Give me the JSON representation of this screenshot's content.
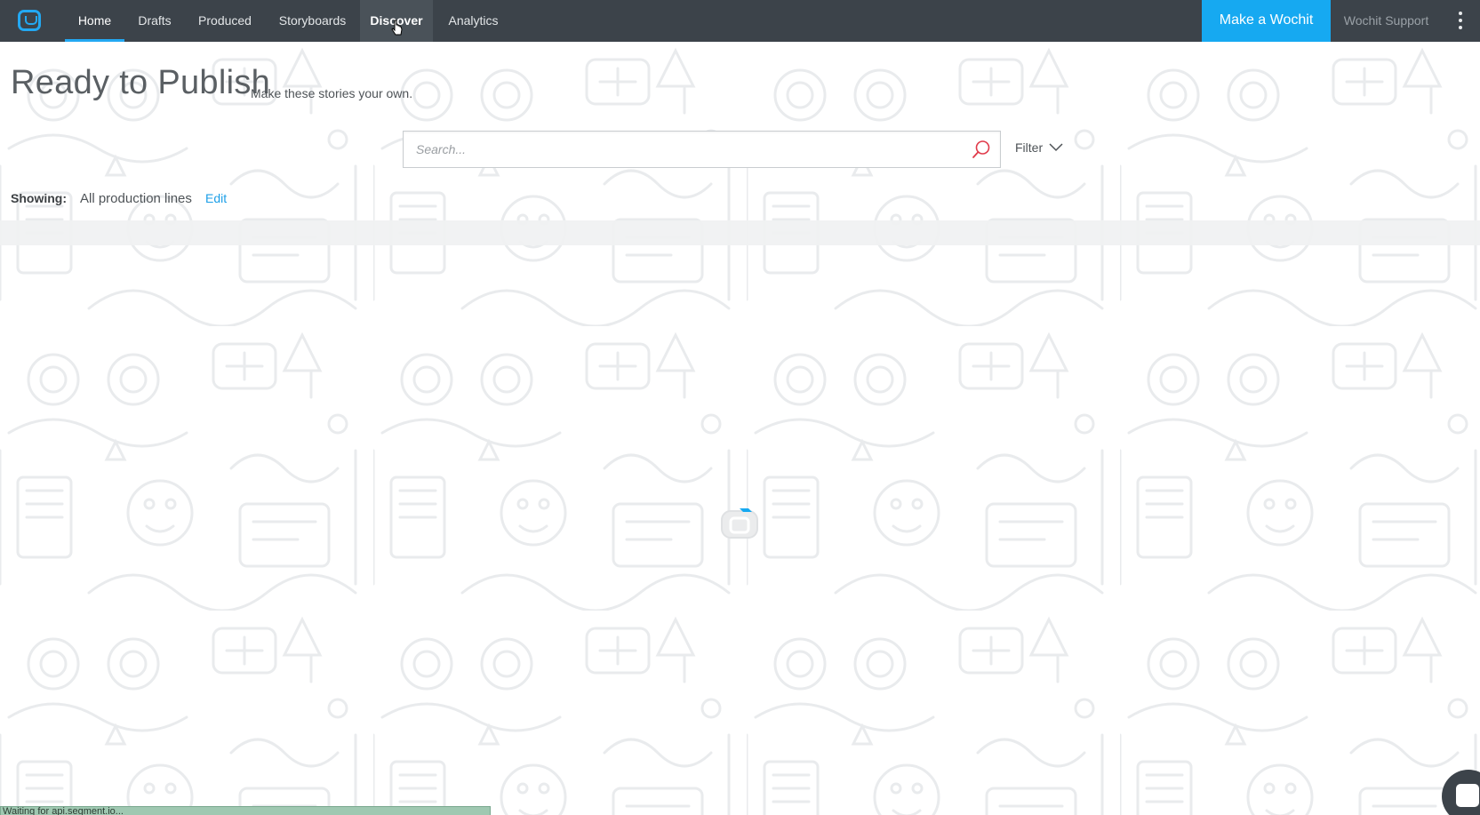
{
  "navbar": {
    "logo": "wochit-logo-icon",
    "items": [
      {
        "label": "Home"
      },
      {
        "label": "Drafts"
      },
      {
        "label": "Produced"
      },
      {
        "label": "Storyboards"
      },
      {
        "label": "Discover"
      },
      {
        "label": "Analytics"
      }
    ],
    "make_button": "Make a Wochit",
    "support": "Wochit Support",
    "menu_icon": "kebab-menu-icon"
  },
  "header": {
    "title": "Ready to Publish",
    "subtitle": "Make these stories your own."
  },
  "search": {
    "placeholder": "Search...",
    "value": ""
  },
  "filter": {
    "label": "Filter"
  },
  "showing": {
    "label": "Showing:",
    "value": "All production lines",
    "edit": "Edit"
  },
  "status_bar": {
    "text": "Waiting for api.segment.io..."
  },
  "colors": {
    "navbar": "#3c434a",
    "accent": "#16a9f1",
    "search_icon": "#e03a4a",
    "link": "#1c9fe8"
  }
}
